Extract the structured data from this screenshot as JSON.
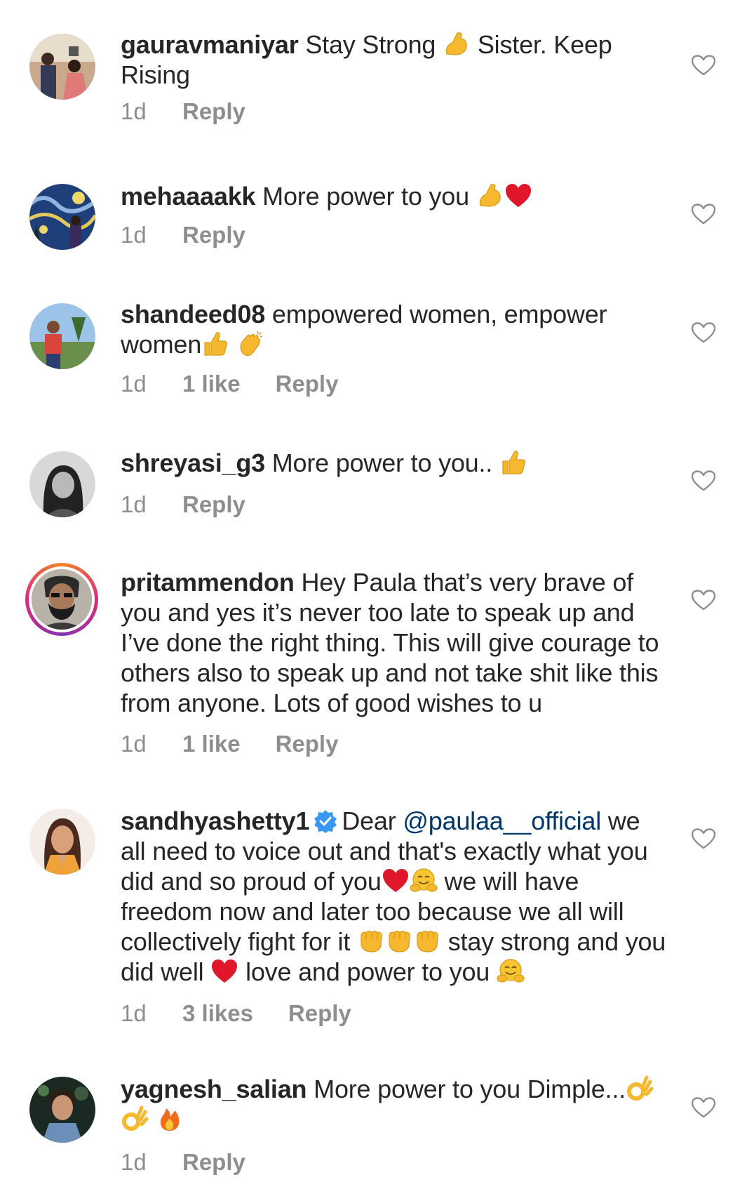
{
  "comments": [
    {
      "username": "gauravmaniyar",
      "text_parts": [
        "Stay Strong ",
        " Sister. Keep Rising"
      ],
      "time": "1d",
      "likes": "",
      "reply": "Reply"
    },
    {
      "username": "mehaaaakk",
      "text_parts": [
        "More power to you "
      ],
      "time": "1d",
      "likes": "",
      "reply": "Reply"
    },
    {
      "username": "shandeed08",
      "text_parts": [
        "empowered women, empower women"
      ],
      "time": "1d",
      "likes": "1 like",
      "reply": "Reply"
    },
    {
      "username": "shreyasi_g3",
      "text_parts": [
        "More power to you.. "
      ],
      "time": "1d",
      "likes": "",
      "reply": "Reply"
    },
    {
      "username": "pritammendon",
      "text_parts": [
        "Hey Paula that’s very brave of you and yes it’s never too late to speak up and I’ve done the right thing. This will give courage to others also to speak up and not take shit like this from anyone. Lots of good wishes to u"
      ],
      "time": "1d",
      "likes": "1 like",
      "reply": "Reply"
    },
    {
      "username": "sandhyashetty1",
      "text_parts": [
        "Dear ",
        "@paulaa__official",
        " we all need to voice out and that's exactly what you did and so proud of you",
        " we will have freedom now and later too because we all will collectively fight for it ",
        " stay strong and you did well ",
        " love and power to you "
      ],
      "time": "1d",
      "likes": "3 likes",
      "reply": "Reply"
    },
    {
      "username": "yagnesh_salian",
      "text_parts": [
        "More power to you Dimple..."
      ],
      "time": "1d",
      "likes": "",
      "reply": "Reply"
    }
  ],
  "icons": {
    "like": "heart-outline-icon",
    "verified": "verified-badge-icon"
  },
  "colors": {
    "text": "#262626",
    "meta": "#8e8e8e",
    "mention": "#00376b",
    "verified": "#3897f0"
  }
}
